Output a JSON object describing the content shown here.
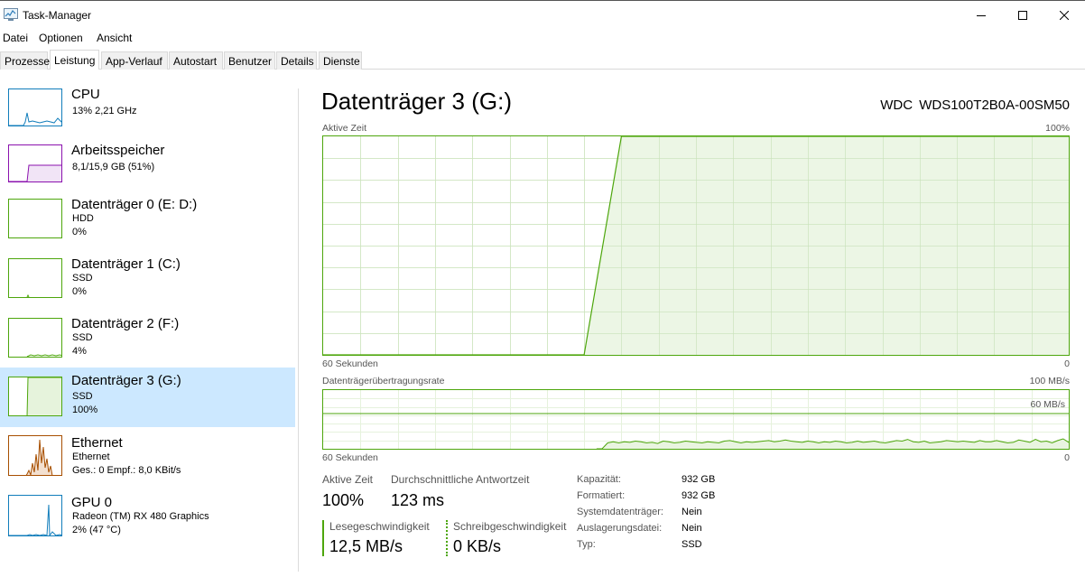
{
  "window": {
    "title": "Task-Manager",
    "icon": "task-manager-icon"
  },
  "menu": [
    "Datei",
    "Optionen",
    "Ansicht"
  ],
  "tabs": [
    "Prozesse",
    "Leistung",
    "App-Verlauf",
    "Autostart",
    "Benutzer",
    "Details",
    "Dienste"
  ],
  "active_tab": "Leistung",
  "sidebar": {
    "items": [
      {
        "title": "CPU",
        "line1": "13% 2,21 GHz",
        "line2": "",
        "color": "#117dbb"
      },
      {
        "title": "Arbeitsspeicher",
        "line1": "8,1/15,9 GB (51%)",
        "line2": "",
        "color": "#8b12ae"
      },
      {
        "title": "Datenträger 0 (E: D:)",
        "line1": "HDD",
        "line2": "0%",
        "color": "#4da60c"
      },
      {
        "title": "Datenträger 1 (C:)",
        "line1": "SSD",
        "line2": "0%",
        "color": "#4da60c"
      },
      {
        "title": "Datenträger 2 (F:)",
        "line1": "SSD",
        "line2": "4%",
        "color": "#4da60c"
      },
      {
        "title": "Datenträger 3 (G:)",
        "line1": "SSD",
        "line2": "100%",
        "color": "#4da60c"
      },
      {
        "title": "Ethernet",
        "line1": "Ethernet",
        "line2": "Ges.: 0 Empf.: 8,0 KBit/s",
        "color": "#a74f01"
      },
      {
        "title": "GPU 0",
        "line1": "Radeon (TM) RX 480 Graphics",
        "line2": "2% (47 °C)",
        "color": "#117dbb"
      }
    ],
    "selected_index": 5
  },
  "main": {
    "title": "Datenträger 3 (G:)",
    "model": "WDC WDS100T2B0A-00SM50",
    "graph1": {
      "label": "Aktive Zeit",
      "max_label": "100%",
      "time_label": "60 Sekunden",
      "zero_label": "0"
    },
    "graph2": {
      "label": "Datenträgerübertragungsrate",
      "max_label": "100 MB/s",
      "line_label": "60 MB/s",
      "time_label": "60 Sekunden",
      "zero_label": "0"
    },
    "stats": {
      "active_time_label": "Aktive Zeit",
      "active_time_value": "100%",
      "response_label": "Durchschnittliche Antwortzeit",
      "response_value": "123 ms",
      "read_label": "Lesegeschwindigkeit",
      "read_value": "12,5 MB/s",
      "write_label": "Schreibgeschwindigkeit",
      "write_value": "0 KB/s"
    },
    "info": [
      {
        "label": "Kapazität:",
        "value": "932 GB"
      },
      {
        "label": "Formatiert:",
        "value": "932 GB"
      },
      {
        "label": "Systemdatenträger:",
        "value": "Nein"
      },
      {
        "label": "Auslagerungsdatei:",
        "value": "Nein"
      },
      {
        "label": "Typ:",
        "value": "SSD"
      }
    ]
  },
  "chart_data": [
    {
      "type": "area",
      "title": "Aktive Zeit",
      "xlabel": "60 Sekunden",
      "ylabel": "",
      "xlim": [
        60,
        0
      ],
      "ylim": [
        0,
        100
      ],
      "x": [
        60,
        39,
        36,
        0
      ],
      "values": [
        0,
        0,
        100,
        100
      ],
      "color": "#4da60c"
    },
    {
      "type": "line",
      "title": "Datenträgerübertragungsrate",
      "xlabel": "60 Sekunden",
      "ylabel": "",
      "xlim": [
        60,
        0
      ],
      "ylim": [
        0,
        100
      ],
      "series": [
        {
          "values": [
            0,
            0,
            10,
            12,
            10,
            12,
            11,
            13,
            12,
            10,
            11,
            9,
            13,
            12,
            10,
            11,
            13,
            12,
            11,
            10,
            12,
            11,
            10,
            13,
            14,
            12,
            10,
            12,
            11,
            12,
            13,
            14,
            12,
            13,
            15,
            13,
            12,
            11,
            13,
            12,
            10,
            12,
            11,
            13,
            12,
            10,
            11,
            13,
            11,
            12,
            13,
            11,
            10,
            12,
            14,
            13,
            16,
            12,
            11,
            13,
            10,
            11,
            12,
            14,
            13,
            12,
            13,
            12,
            11,
            14,
            12,
            12,
            14,
            12,
            10,
            11,
            15,
            13,
            11,
            16,
            12,
            13,
            10,
            14,
            17,
            11
          ],
          "start_x": 38
        }
      ],
      "reference_line": 60,
      "color": "#4da60c"
    }
  ]
}
